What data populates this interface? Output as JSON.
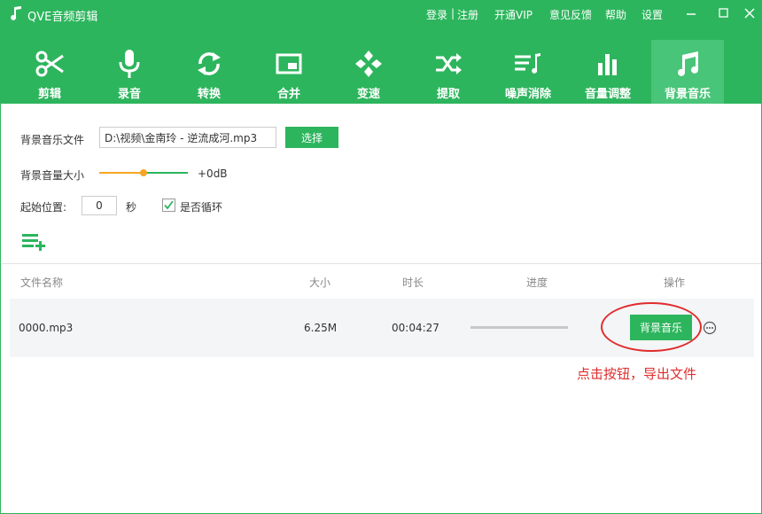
{
  "app": {
    "title": "QVE音频剪辑"
  },
  "topbar": {
    "login": "登录",
    "separator": "|",
    "register": "注册",
    "vip": "开通VIP",
    "feedback": "意见反馈",
    "help": "帮助",
    "settings": "设置"
  },
  "toolbar": {
    "items": [
      {
        "label": "剪辑",
        "icon": "scissors-icon"
      },
      {
        "label": "录音",
        "icon": "microphone-icon"
      },
      {
        "label": "转换",
        "icon": "convert-icon"
      },
      {
        "label": "合并",
        "icon": "merge-icon"
      },
      {
        "label": "变速",
        "icon": "speed-icon"
      },
      {
        "label": "提取",
        "icon": "shuffle-extract-icon"
      },
      {
        "label": "噪声消除",
        "icon": "noise-reduction-icon"
      },
      {
        "label": "音量调整",
        "icon": "volume-bars-icon"
      },
      {
        "label": "背景音乐",
        "icon": "music-note-icon"
      }
    ],
    "active_index": 8
  },
  "form": {
    "bgm_file_label": "背景音乐文件",
    "bgm_file_value": "D:\\视频\\金南玲 - 逆流成河.mp3",
    "choose_button": "选择",
    "volume_label": "背景音量大小",
    "volume_value": "+0dB",
    "volume_position": 0.5,
    "start_label": "起始位置:",
    "start_value": "0",
    "start_unit": "秒",
    "loop_label": "是否循环",
    "loop_checked": true
  },
  "table": {
    "headers": {
      "name": "文件名称",
      "size": "大小",
      "duration": "时长",
      "progress": "进度",
      "action": "操作"
    },
    "rows": [
      {
        "name": "0000.mp3",
        "size": "6.25M",
        "duration": "00:04:27",
        "progress": 0,
        "action_button": "背景音乐"
      }
    ]
  },
  "annotation": {
    "text": "点击按钮，导出文件"
  },
  "colors": {
    "brand": "#2db55d",
    "annotation": "#e02d2d",
    "slider_accent": "#f5a623"
  }
}
